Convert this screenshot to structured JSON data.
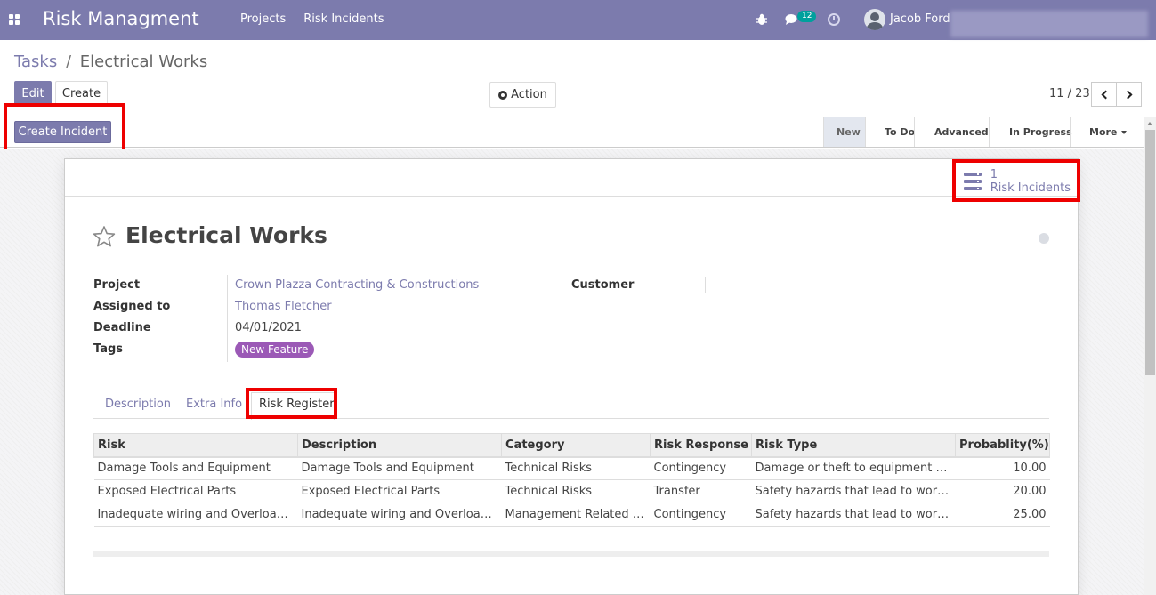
{
  "navbar": {
    "app_title": "Risk Managment",
    "menu": [
      "Projects",
      "Risk Incidents"
    ],
    "chat_badge": "12",
    "user_name": "Jacob Ford",
    "color": "#7c7bad"
  },
  "breadcrumb": {
    "parent": "Tasks",
    "separator": "/",
    "current": "Electrical Works"
  },
  "toolbar": {
    "edit_label": "Edit",
    "create_label": "Create",
    "action_label": "Action"
  },
  "pager": {
    "value": "11 / 23"
  },
  "statusbar": {
    "create_incident_label": "Create Incident",
    "stages": [
      {
        "label": "New",
        "active": true
      },
      {
        "label": "To Do",
        "active": false
      },
      {
        "label": "Advanced",
        "active": false
      },
      {
        "label": "In Progress",
        "active": false
      },
      {
        "label": "More",
        "active": false
      }
    ]
  },
  "smart_button": {
    "count": "1",
    "label": "Risk Incidents"
  },
  "record": {
    "title": "Electrical Works",
    "fields": {
      "project_label": "Project",
      "project_value": "Crown Plazza Contracting & Constructions",
      "assigned_label": "Assigned to",
      "assigned_value": "Thomas Fletcher",
      "deadline_label": "Deadline",
      "deadline_value": "04/01/2021",
      "tags_label": "Tags",
      "tag_value": "New Feature",
      "customer_label": "Customer"
    }
  },
  "tabs": [
    "Description",
    "Extra Info",
    "Risk Register"
  ],
  "risk_table": {
    "headers": [
      "Risk",
      "Description",
      "Category",
      "Risk Response",
      "Risk Type",
      "Probablity(%)"
    ],
    "rows": [
      [
        "Damage Tools and Equipment",
        "Damage Tools and Equipment",
        "Technical Risks",
        "Contingency",
        "Damage or theft to equipment and tools",
        "10.00"
      ],
      [
        "Exposed Electrical Parts",
        "Exposed Electrical Parts",
        "Technical Risks",
        "Transfer",
        "Safety hazards that lead to worker injuries",
        "20.00"
      ],
      [
        "Inadequate wiring and Overloaded circuits",
        "Inadequate wiring and Overloaded circuits",
        "Management Related Risks",
        "Contingency",
        "Safety hazards that lead to worker injuries",
        "25.00"
      ]
    ]
  }
}
